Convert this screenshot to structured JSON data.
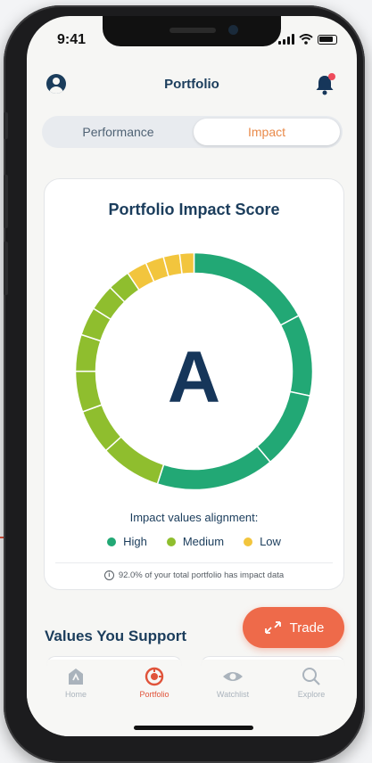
{
  "status_bar": {
    "time": "9:41"
  },
  "header": {
    "title": "Portfolio",
    "avatar_icon": "user-avatar-icon",
    "bell_icon": "bell-icon"
  },
  "segmented": {
    "tabs": [
      "Performance",
      "Impact"
    ],
    "selected": "Impact"
  },
  "impact_card": {
    "title": "Portfolio Impact Score",
    "grade": "A",
    "alignment_label": "Impact values alignment:",
    "legend": [
      {
        "label": "High",
        "color": "#22a875"
      },
      {
        "label": "Medium",
        "color": "#8fbe2e"
      },
      {
        "label": "Low",
        "color": "#f2c53d"
      }
    ],
    "info_text": "92.0% of your total portfolio has impact data"
  },
  "donut_segments": [
    {
      "level": "high",
      "degrees": 62
    },
    {
      "level": "high",
      "degrees": 40
    },
    {
      "level": "high",
      "degrees": 38
    },
    {
      "level": "high",
      "degrees": 58
    },
    {
      "level": "medium",
      "degrees": 30
    },
    {
      "level": "medium",
      "degrees": 22
    },
    {
      "level": "medium",
      "degrees": 20
    },
    {
      "level": "medium",
      "degrees": 18
    },
    {
      "level": "medium",
      "degrees": 14
    },
    {
      "level": "medium",
      "degrees": 13
    },
    {
      "level": "medium",
      "degrees": 11
    },
    {
      "level": "low",
      "degrees": 10
    },
    {
      "level": "low",
      "degrees": 9
    },
    {
      "level": "low",
      "degrees": 8
    },
    {
      "level": "low",
      "degrees": 7
    }
  ],
  "values_section": {
    "title": "Values You Support"
  },
  "trade_button": {
    "label": "Trade",
    "icon": "trade-arrows-icon"
  },
  "tab_bar": {
    "items": [
      {
        "label": "Home",
        "icon": "home-icon",
        "active": false
      },
      {
        "label": "Portfolio",
        "icon": "portfolio-icon",
        "active": true
      },
      {
        "label": "Watchlist",
        "icon": "eye-icon",
        "active": false
      },
      {
        "label": "Explore",
        "icon": "search-icon",
        "active": false
      }
    ]
  }
}
